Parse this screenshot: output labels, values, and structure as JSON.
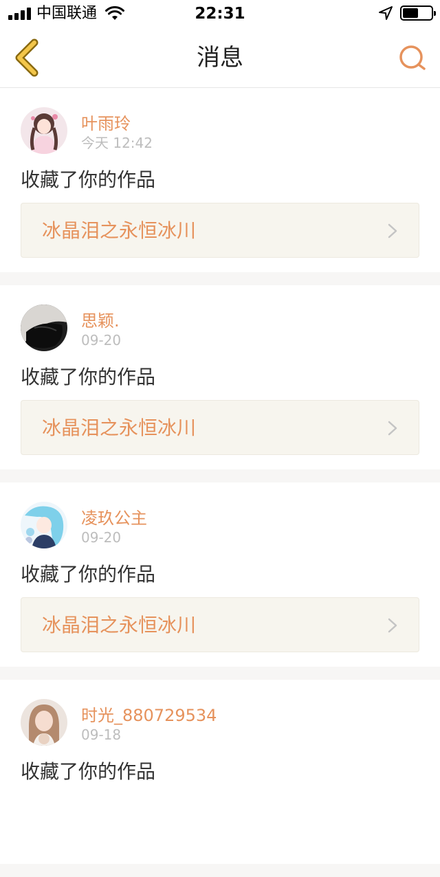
{
  "status_bar": {
    "carrier": "中国联通",
    "time": "22:31",
    "signal_bars": 4,
    "battery_level": 0.55,
    "icons": [
      "signal-icon",
      "wifi-icon",
      "location-arrow-icon",
      "battery-icon"
    ]
  },
  "nav": {
    "title": "消息",
    "back_icon": "chevron-left-icon",
    "search_icon": "search-icon",
    "accent_color": "#e6925c",
    "back_color": "#f3c64a"
  },
  "messages": [
    {
      "username": "叶雨玲",
      "time": "今天 12:42",
      "action": "收藏了你的作品",
      "work_title": "冰晶泪之永恒冰川",
      "avatar": "anime-girl-avatar"
    },
    {
      "username": "思颖.",
      "time": "09-20",
      "action": "收藏了你的作品",
      "work_title": "冰晶泪之永恒冰川",
      "avatar": "dark-hair-avatar"
    },
    {
      "username": "凌玖公主",
      "time": "09-20",
      "action": "收藏了你的作品",
      "work_title": "冰晶泪之永恒冰川",
      "avatar": "blue-anime-avatar"
    },
    {
      "username": "时光_880729534",
      "time": "09-18",
      "action": "收藏了你的作品",
      "work_title": "",
      "avatar": "girl-photo-avatar"
    }
  ]
}
